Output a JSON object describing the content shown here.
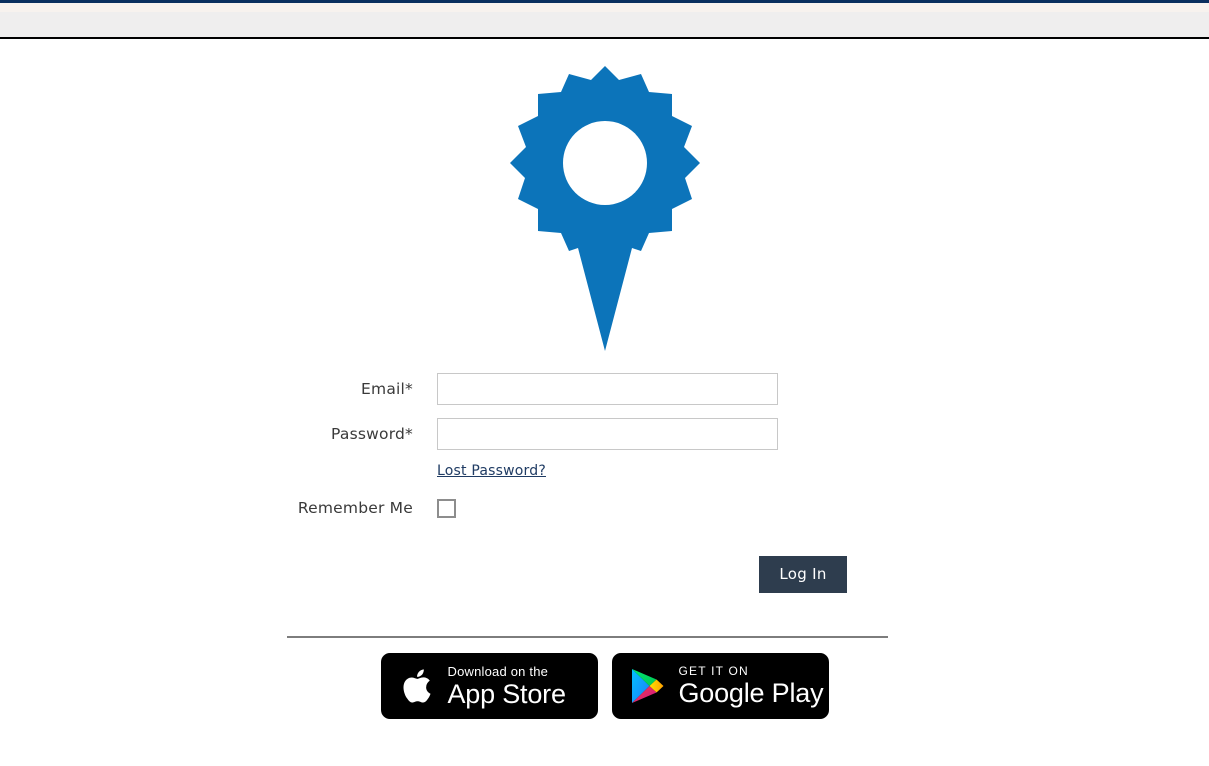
{
  "chrome": {
    "accent_top_color": "#0a2f5e",
    "bar_background": "#efeeee"
  },
  "logo": {
    "name": "gear-map-pin-logo",
    "color": "#0c74ba"
  },
  "form": {
    "email": {
      "label": "Email*",
      "value": "",
      "placeholder": ""
    },
    "password": {
      "label": "Password*",
      "value": "",
      "placeholder": ""
    },
    "lost_password_label": "Lost Password?",
    "remember_me_label": "Remember Me",
    "remember_me_checked": false,
    "login_button_label": "Log In",
    "link_color": "#1f3b63",
    "button_color": "#2e3d4e"
  },
  "badges": {
    "app_store": {
      "small_text": "Download on the",
      "large_text": "App Store",
      "icon": "apple-icon"
    },
    "google_play": {
      "small_text": "GET IT ON",
      "large_text": "Google Play",
      "icon": "google-play-icon"
    }
  }
}
